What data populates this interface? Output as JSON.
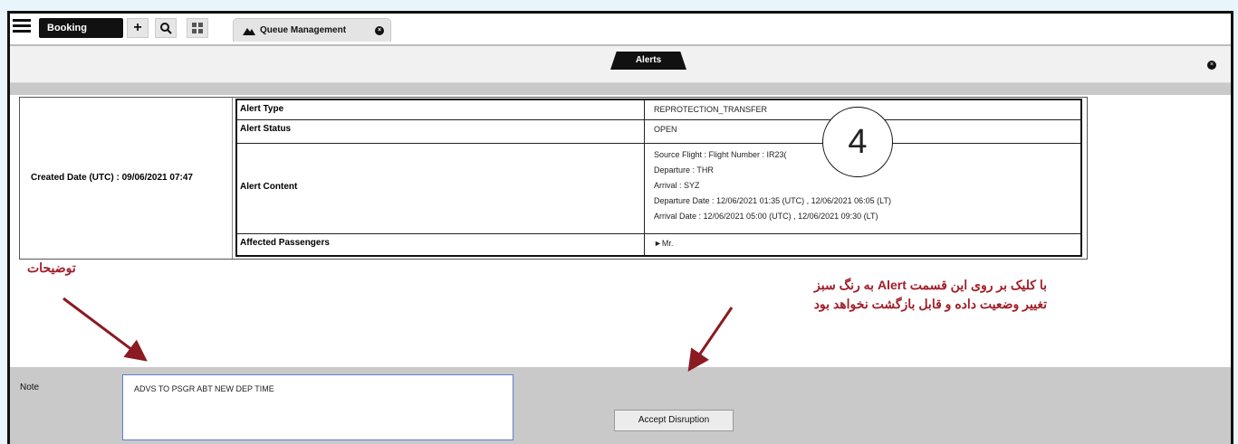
{
  "toolbar": {
    "booking_label": "Booking",
    "plus_icon": "+",
    "search_icon": "🔍",
    "grid_icon": "▦",
    "tab_label": "Queue Management",
    "tab_close": "×"
  },
  "alerts": {
    "tab_label": "Alerts",
    "close": "×",
    "created_date": "Created Date (UTC) : 09/06/2021 07:47",
    "rows": [
      {
        "key": "Alert Type",
        "value": "REPROTECTION_TRANSFER"
      },
      {
        "key": "Alert Status",
        "value": "OPEN"
      },
      {
        "key": "Alert Content",
        "lines": [
          "Source Flight : Flight Number : IR23(",
          "Departure : THR",
          "Arrival : SYZ",
          "Departure Date : 12/06/2021 01:35 (UTC) , 12/06/2021 06:05 (LT)",
          "Arrival Date : 12/06/2021 05:00 (UTC) , 12/06/2021 09:30 (LT)"
        ]
      },
      {
        "key": "Affected Passengers",
        "value": "►Mr."
      }
    ]
  },
  "badge_number": "4",
  "annotations": {
    "left": "توضیحات",
    "right_line1": "با کلیک بر روی این قسمت Alert به رنگ سبز",
    "right_line2": "تغییر وضعیت داده و قابل بازگشت نخواهد بود"
  },
  "note": {
    "label": "Note",
    "value": "ADVS TO PSGR ABT NEW DEP TIME"
  },
  "accept_button": "Accept Disruption",
  "colors": {
    "annotation": "#a11e28",
    "toolbar_dark": "#111111",
    "note_area": "#c9c9c9"
  }
}
